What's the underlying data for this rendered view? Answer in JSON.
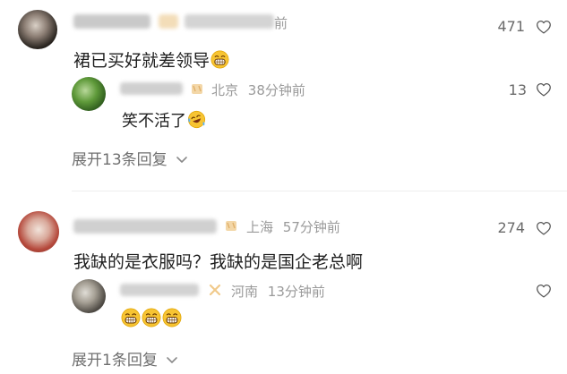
{
  "comments": [
    {
      "meta": {
        "prefix": "前"
      },
      "text": "裙已买好就差领导",
      "like_count": "471",
      "reply": {
        "meta": {
          "location": "北京",
          "time": "38分钟前"
        },
        "text": "笑不活了",
        "like_count": "13"
      },
      "expand_label": "展开13条回复"
    },
    {
      "meta": {
        "location": "上海",
        "time": "57分钟前"
      },
      "text": "我缺的是衣服吗？我缺的是国企老总啊",
      "like_count": "274",
      "reply": {
        "meta": {
          "location": "河南",
          "time": "13分钟前"
        },
        "text": "",
        "like_count": ""
      },
      "expand_label": "展开1条回复"
    }
  ],
  "icons": {
    "like": "heart-outline-icon",
    "expand": "chevron-down-icon",
    "grin_emoji": "grinning-face-emoji",
    "laugh_cry_emoji": "laughing-crying-face-emoji",
    "location_badge": "badge-icon"
  },
  "colors": {
    "meta_text": "#9a9a9a",
    "location_badge": "#f0c98a",
    "emoji_yellow": "#f7c433"
  }
}
